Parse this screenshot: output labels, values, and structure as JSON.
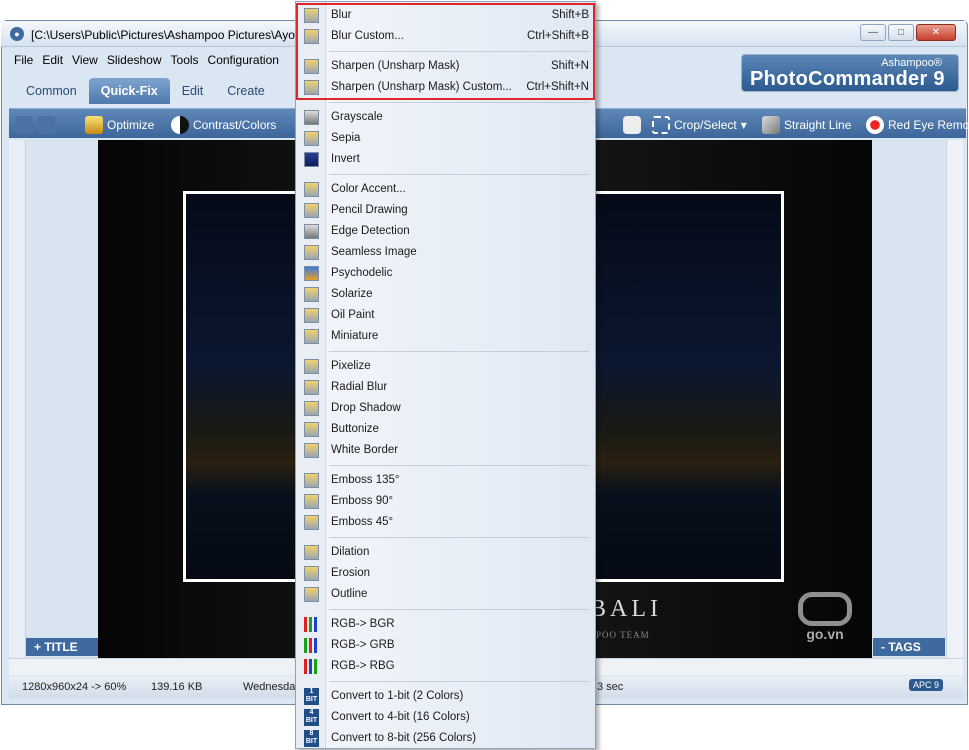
{
  "window": {
    "title": "[C:\\Users\\Public\\Pictures\\Ashampoo Pictures\\Ayo",
    "buttons": [
      "—",
      "□",
      "✕"
    ]
  },
  "menubar": [
    "File",
    "Edit",
    "View",
    "Slideshow",
    "Tools",
    "Configuration"
  ],
  "tabs": [
    {
      "label": "Common",
      "active": false
    },
    {
      "label": "Quick-Fix",
      "active": true
    },
    {
      "label": "Edit",
      "active": false
    },
    {
      "label": "Create",
      "active": false
    }
  ],
  "brand": {
    "sub": "Ashampoo®",
    "main": "PhotoCommander 9"
  },
  "toolbar": {
    "optimize": "Optimize",
    "contrast": "Contrast/Colors",
    "crop": "Crop/Select",
    "straight": "Straight Line",
    "redeye": "Red Eye Remo"
  },
  "panels": {
    "title": "+ TITLE",
    "tags": "- TAGS"
  },
  "image": {
    "caption": "BALI",
    "team": "POO TEAM",
    "watermark": "go.vn"
  },
  "status": {
    "dims": "1280x960x24 -> 60%",
    "size": "139.16 KB",
    "date": "Wednesda",
    "time": "3 sec",
    "badge": "APC 9"
  },
  "menu": {
    "items": [
      {
        "label": "Blur",
        "shortcut": "Shift+B"
      },
      {
        "label": "Blur Custom...",
        "shortcut": "Ctrl+Shift+B"
      },
      {
        "label": "Sharpen (Unsharp Mask)",
        "shortcut": "Shift+N"
      },
      {
        "label": "Sharpen (Unsharp Mask) Custom...",
        "shortcut": "Ctrl+Shift+N"
      },
      {
        "label": "Grayscale",
        "shortcut": ""
      },
      {
        "label": "Sepia",
        "shortcut": ""
      },
      {
        "label": "Invert",
        "shortcut": ""
      },
      {
        "label": "Color Accent...",
        "shortcut": ""
      },
      {
        "label": "Pencil Drawing",
        "shortcut": ""
      },
      {
        "label": "Edge Detection",
        "shortcut": ""
      },
      {
        "label": "Seamless Image",
        "shortcut": ""
      },
      {
        "label": "Psychodelic",
        "shortcut": ""
      },
      {
        "label": "Solarize",
        "shortcut": ""
      },
      {
        "label": "Oil Paint",
        "shortcut": ""
      },
      {
        "label": "Miniature",
        "shortcut": ""
      },
      {
        "label": "Pixelize",
        "shortcut": ""
      },
      {
        "label": "Radial Blur",
        "shortcut": ""
      },
      {
        "label": "Drop Shadow",
        "shortcut": ""
      },
      {
        "label": "Buttonize",
        "shortcut": ""
      },
      {
        "label": "White Border",
        "shortcut": ""
      },
      {
        "label": "Emboss 135°",
        "shortcut": ""
      },
      {
        "label": "Emboss 90°",
        "shortcut": ""
      },
      {
        "label": "Emboss 45°",
        "shortcut": ""
      },
      {
        "label": "Dilation",
        "shortcut": ""
      },
      {
        "label": "Erosion",
        "shortcut": ""
      },
      {
        "label": "Outline",
        "shortcut": ""
      },
      {
        "label": "RGB-> BGR",
        "shortcut": ""
      },
      {
        "label": "RGB-> GRB",
        "shortcut": ""
      },
      {
        "label": "RGB-> RBG",
        "shortcut": ""
      },
      {
        "label": "Convert to 1-bit (2 Colors)",
        "shortcut": ""
      },
      {
        "label": "Convert to 4-bit (16 Colors)",
        "shortcut": ""
      },
      {
        "label": "Convert to 8-bit (256 Colors)",
        "shortcut": ""
      }
    ],
    "bit_icons": [
      "1 BIT",
      "4 BIT",
      "8 BIT"
    ]
  },
  "colors": {
    "accent": "#3f6aa0",
    "highlight": "#e0262a"
  }
}
